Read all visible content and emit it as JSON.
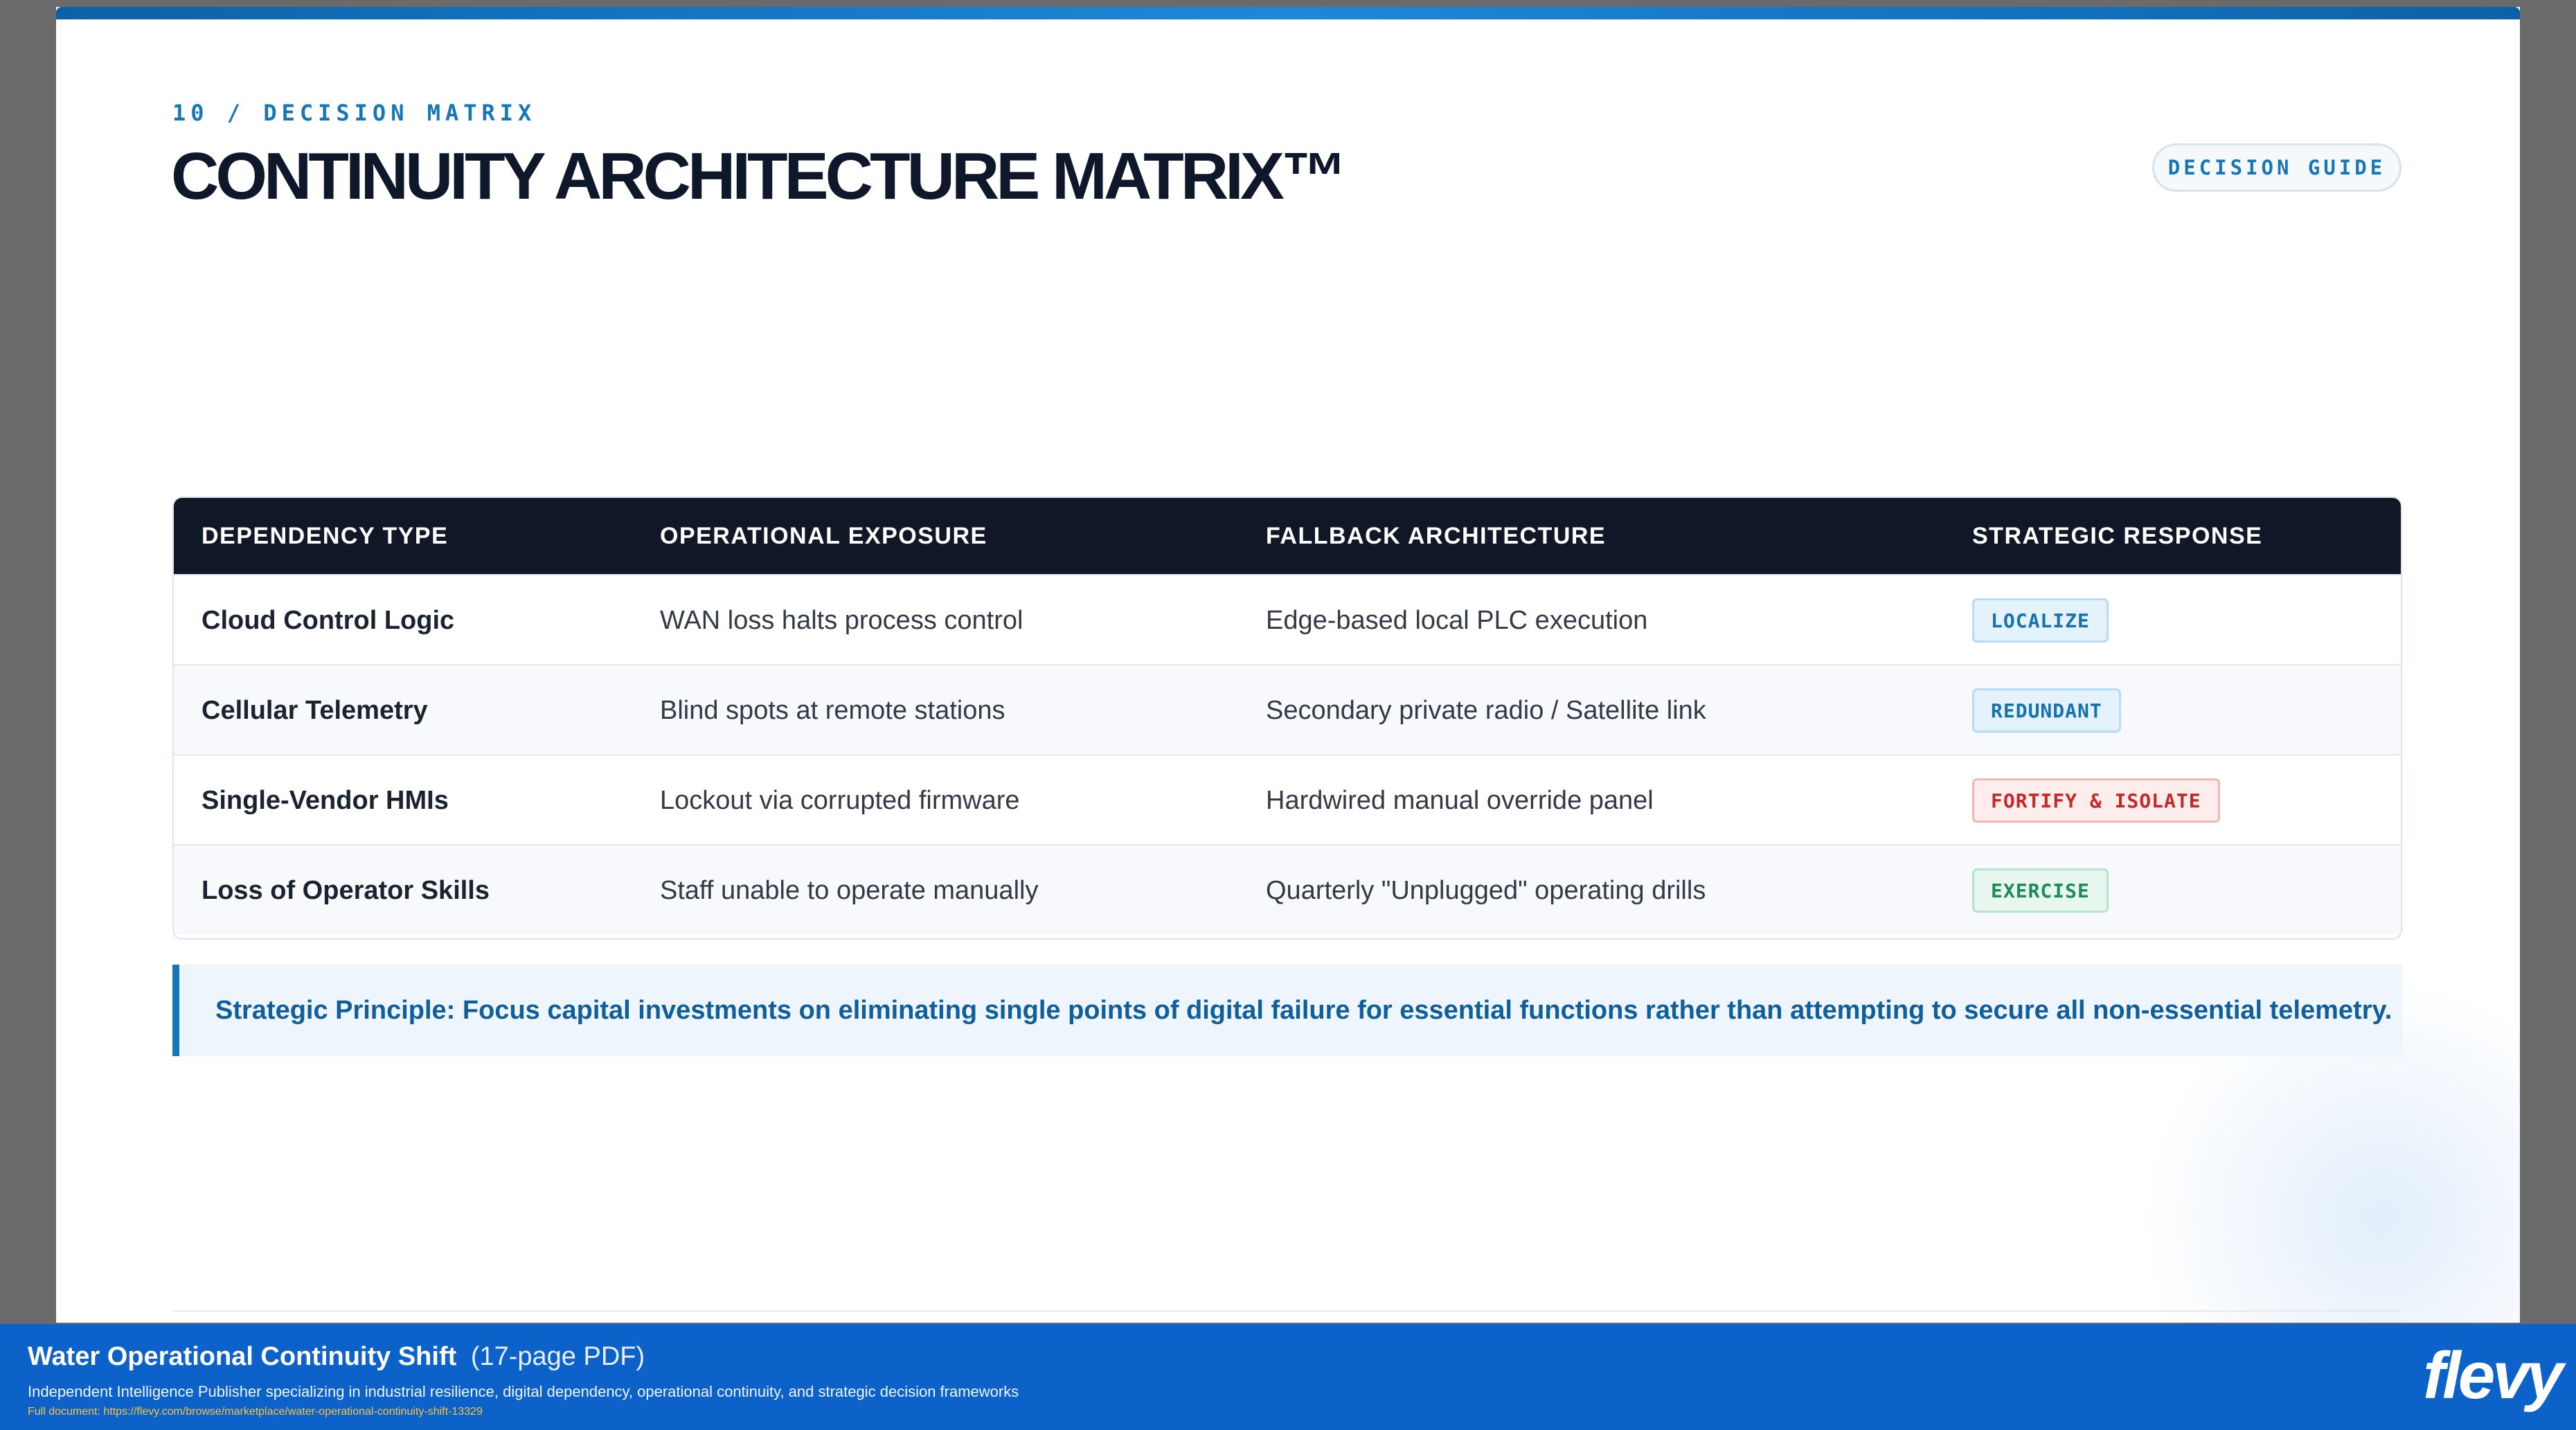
{
  "slide": {
    "kicker": "10 / DECISION MATRIX",
    "title": "CONTINUITY ARCHITECTURE MATRIX™",
    "badge": "DECISION GUIDE"
  },
  "table": {
    "headers": [
      "DEPENDENCY TYPE",
      "OPERATIONAL EXPOSURE",
      "FALLBACK ARCHITECTURE",
      "STRATEGIC RESPONSE"
    ],
    "rows": [
      {
        "dependency": "Cloud Control Logic",
        "exposure": "WAN loss halts process control",
        "fallback": "Edge-based local PLC execution",
        "response": "LOCALIZE",
        "response_color": "#1671ad"
      },
      {
        "dependency": "Cellular Telemetry",
        "exposure": "Blind spots at remote stations",
        "fallback": "Secondary private radio / Satellite link",
        "response": "REDUNDANT",
        "response_color": "#1671ad"
      },
      {
        "dependency": "Single-Vendor HMIs",
        "exposure": "Lockout via corrupted firmware",
        "fallback": "Hardwired manual override panel",
        "response": "FORTIFY & ISOLATE",
        "response_color": "#c62828"
      },
      {
        "dependency": "Loss of Operator Skills",
        "exposure": "Staff unable to operate manually",
        "fallback": "Quarterly \"Unplugged\" operating drills",
        "response": "EXERCISE",
        "response_color": "#1d8a57"
      }
    ]
  },
  "principle": "Strategic Principle: Focus capital investments on eliminating single points of digital failure for essential functions rather than attempting to secure all non-essential telemetry.",
  "banner": {
    "title": "Water Operational Continuity Shift",
    "pages": "(17-page PDF)",
    "description": "Independent Intelligence Publisher specializing in industrial resilience, digital dependency, operational continuity, and strategic decision frameworks",
    "link": "Full document: https://flevy.com/browse/marketplace/water-operational-continuity-shift-13329",
    "logo": "flevy"
  },
  "colors": {
    "accent": "#1577b8",
    "header_bg": "#101828",
    "banner_bg": "#0d62c9"
  }
}
